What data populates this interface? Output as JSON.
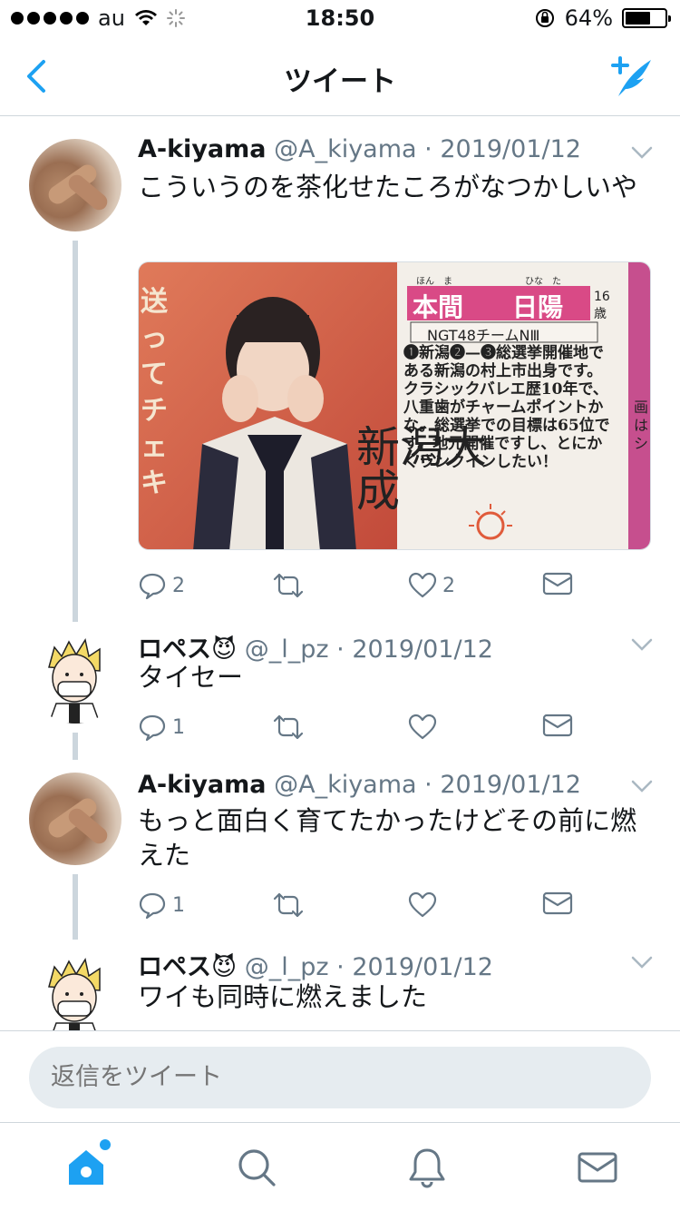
{
  "status_bar": {
    "carrier": "au",
    "time": "18:50",
    "battery": "64%",
    "battery_level": 0.64,
    "signal_bars": 5
  },
  "nav": {
    "title": "ツイート",
    "back_icon": "chevron-left-icon",
    "compose_icon": "compose-tweet-icon"
  },
  "colors": {
    "accent": "#1da1f2",
    "secondary_text": "#657786",
    "thread_line": "#ccd6dd"
  },
  "tweets": [
    {
      "name": "A-kiyama",
      "handle": "@A_kiyama",
      "date": "· 2019/01/12",
      "text": "こういうのを茶化せたころがなつかしいや",
      "replies": "2",
      "retweets": "",
      "likes": "2",
      "media": {
        "heading_name_1": "本間",
        "heading_name_2": "日陽",
        "ruby_1": "ほん　ま",
        "ruby_2": "ひな　た",
        "age_number": "16",
        "age_unit": "歳",
        "team": "NGT48チームNⅢ",
        "article": "❶新潟❷—❸総選挙開催地である新潟の村上市出身です。クラシックバレエ歴10年で、八重歯がチャームポイントかな。総選挙での目標は65位です。地元開催ですし、とにかくランクインしたい！",
        "big_text": "新潟大成",
        "side_text": "送ってチェキ",
        "right_edge_text": "画はシ"
      }
    },
    {
      "name": "ロペス😈",
      "handle": "@_l_pz",
      "date": "· 2019/01/12",
      "text": "タイセー",
      "replies": "1",
      "retweets": "",
      "likes": ""
    },
    {
      "name": "A-kiyama",
      "handle": "@A_kiyama",
      "date": "· 2019/01/12",
      "text": "もっと面白く育てたかったけどその前に燃えた",
      "replies": "1",
      "retweets": "",
      "likes": ""
    },
    {
      "name": "ロペス😈",
      "handle": "@_l_pz",
      "date": "· 2019/01/12",
      "text": "ワイも同時に燃えました"
    }
  ],
  "reply": {
    "placeholder": "返信をツイート"
  },
  "tabs": [
    "home-icon",
    "search-icon",
    "notifications-icon",
    "messages-icon"
  ]
}
